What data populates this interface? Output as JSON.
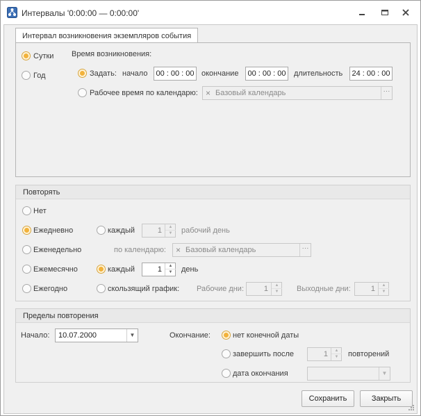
{
  "window": {
    "title": "Интервалы '0:00:00 — 0:00:00'",
    "controls": [
      "minimize-icon",
      "maximize-icon",
      "close-icon"
    ]
  },
  "occurrence": {
    "tab_label": "Интервал возникновения экземпляров события",
    "period": {
      "day": "Сутки",
      "year": "Год",
      "selected": "day"
    },
    "time_caption": "Время возникновения:",
    "set_label": "Задать:",
    "start_label": "начало",
    "start_value": "00 : 00 : 00",
    "end_label": "окончание",
    "end_value": "00 : 00 : 00",
    "duration_label": "длительность",
    "duration_value": "24 : 00 : 00",
    "work_time_label": "Рабочее время по календарю:",
    "calendar_value": "Базовый календарь"
  },
  "repeat": {
    "header": "Повторять",
    "none": "Нет",
    "daily": "Ежедневно",
    "weekly": "Еженедельно",
    "monthly": "Ежемесячно",
    "yearly": "Ежегодно",
    "selected": "daily",
    "every_label": "каждый",
    "workday_value": "1",
    "workday_label": "рабочий день",
    "by_calendar_label": "по календарю:",
    "calendar_value": "Базовый календарь",
    "every_day_value": "1",
    "day_label": "день",
    "sliding_label": "скользящий график:",
    "workdays_label": "Рабочие дни:",
    "workdays_value": "1",
    "weekends_label": "Выходные дни:",
    "weekends_value": "1"
  },
  "limits": {
    "header": "Пределы повторения",
    "start_label": "Начало:",
    "start_value": "10.07.2000",
    "end_label": "Окончание:",
    "no_end": "нет конечной даты",
    "finish_after": "завершить после",
    "count_value": "1",
    "repetitions": "повторений",
    "end_date": "дата окончания",
    "selected": "no_end"
  },
  "buttons": {
    "save": "Сохранить",
    "close": "Закрыть"
  },
  "colors": {
    "accent": "#f2b23c",
    "panel": "#f0f0f0",
    "border": "#b5b5b5"
  }
}
